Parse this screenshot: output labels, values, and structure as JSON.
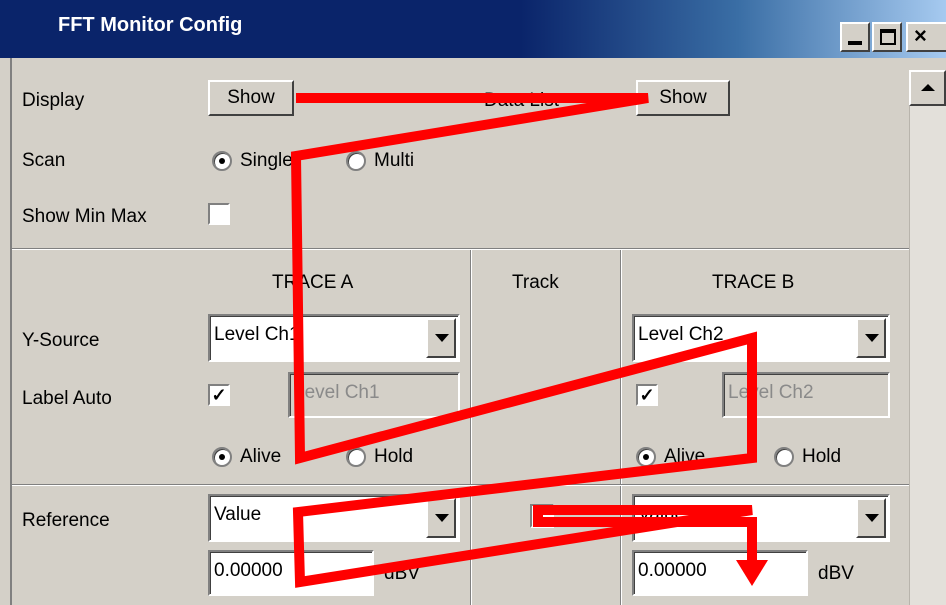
{
  "window": {
    "title": "FFT Monitor Config"
  },
  "display": {
    "label": "Display",
    "show_button": "Show",
    "data_list_label": "Data List",
    "data_list_button": "Show"
  },
  "scan": {
    "label": "Scan",
    "options": [
      "Single",
      "Multi"
    ],
    "selected": "Single"
  },
  "show_min_max": {
    "label": "Show Min Max",
    "checked": false
  },
  "headers": {
    "trace_a": "TRACE A",
    "track": "Track",
    "trace_b": "TRACE B"
  },
  "y_source": {
    "label": "Y-Source",
    "trace_a": "Level Ch1",
    "trace_b": "Level Ch2"
  },
  "label_auto": {
    "label": "Label Auto",
    "trace_a_checked": true,
    "trace_a_text": "Level Ch1",
    "trace_b_checked": true,
    "trace_b_text": "Level Ch2"
  },
  "mode": {
    "options": [
      "Alive",
      "Hold"
    ],
    "trace_a_selected": "Alive",
    "trace_b_selected": "Alive"
  },
  "reference": {
    "label": "Reference",
    "trace_a": "Value",
    "trace_b": "Value",
    "track_checked": false,
    "trace_a_value": "0.00000",
    "trace_b_value": "0.00000",
    "unit": "dBV"
  },
  "annotation": {
    "color": "#ff0000"
  }
}
